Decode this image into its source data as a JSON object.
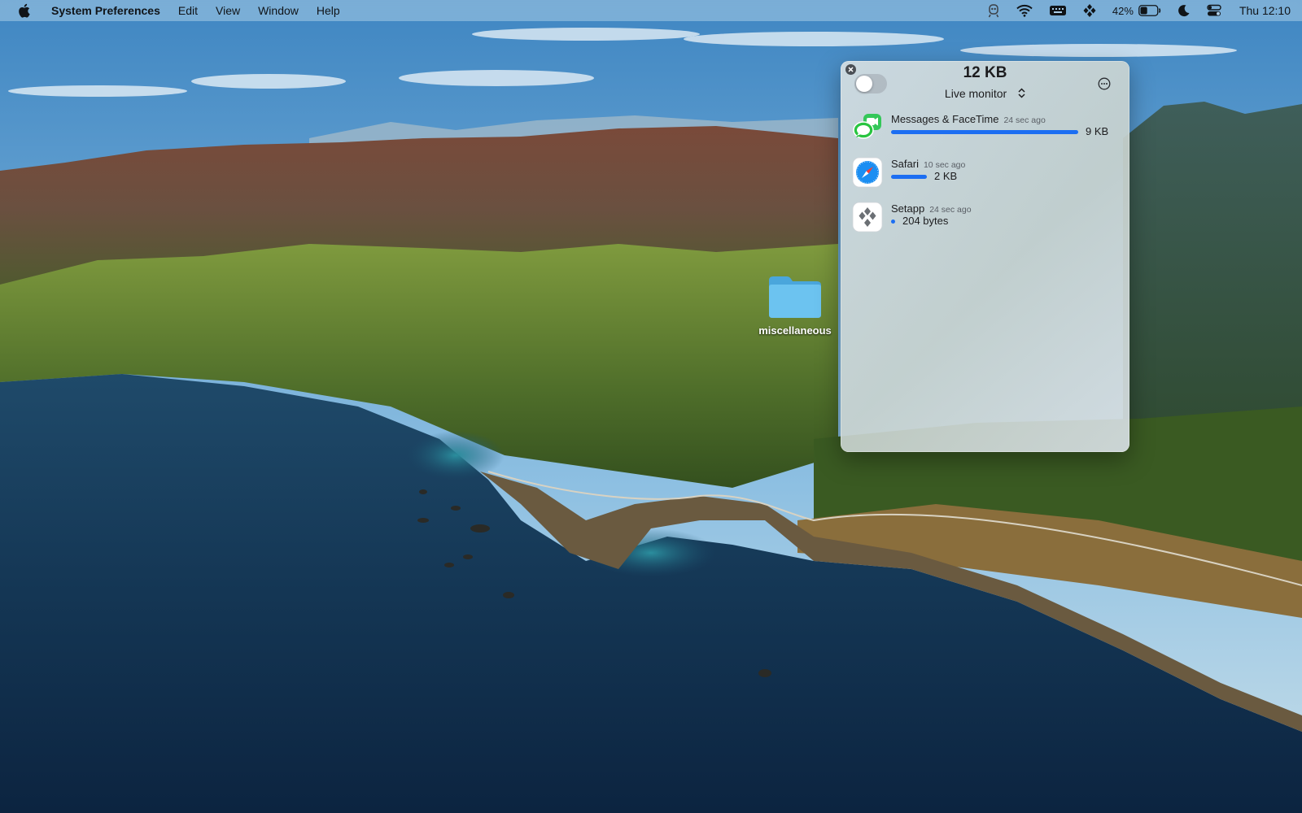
{
  "menubar": {
    "app_name": "System Preferences",
    "menus": [
      "Edit",
      "View",
      "Window",
      "Help"
    ],
    "status_icons": [
      "robot-icon",
      "wifi-icon",
      "keyboard-icon",
      "setapp-icon"
    ],
    "battery_percent": "42%",
    "battery_level": 0.42,
    "clock": "Thu 12:10"
  },
  "desktop": {
    "folder_label": "miscellaneous"
  },
  "panel": {
    "total": "12 KB",
    "mode": "Live monitor",
    "toggle_on": false,
    "apps": [
      {
        "name": "Messages & FaceTime",
        "time": "24 sec ago",
        "size": "9 KB",
        "share": 1.0,
        "icon": "messages-facetime-icon"
      },
      {
        "name": "Safari",
        "time": "10 sec ago",
        "size": "2 KB",
        "share": 0.19,
        "icon": "safari-icon"
      },
      {
        "name": "Setapp",
        "time": "24 sec ago",
        "size": "204 bytes",
        "share": 0.02,
        "icon": "setapp-icon"
      }
    ]
  },
  "colors": {
    "accent": "#1c6ef2",
    "menubar": "#aacde8",
    "folder": "#5ab8ec"
  }
}
